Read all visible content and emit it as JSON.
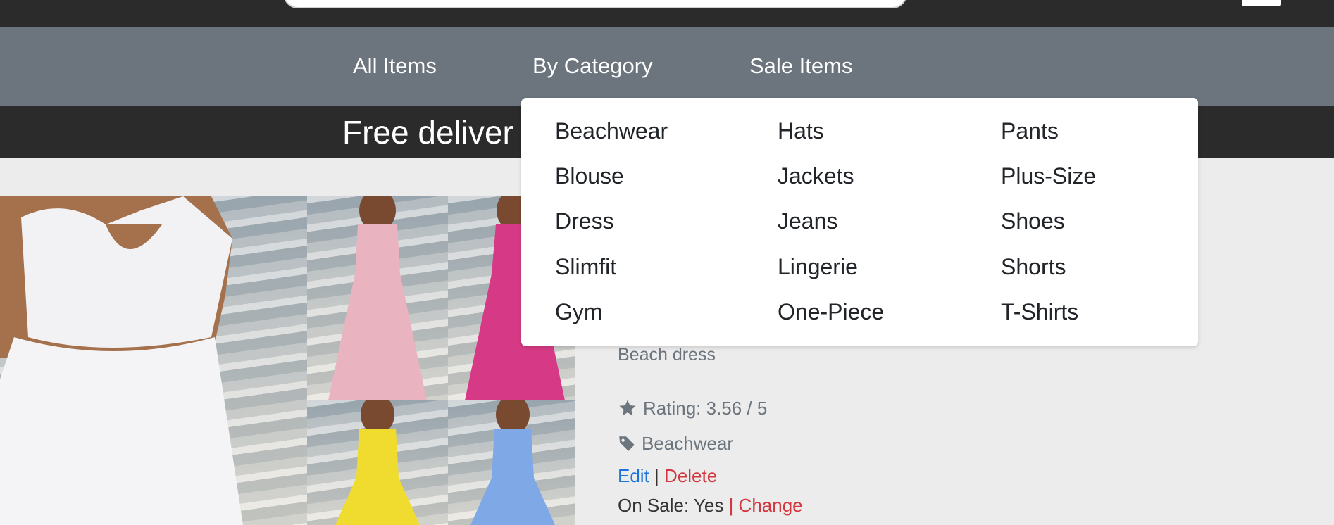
{
  "nav": {
    "all_items": "All Items",
    "by_category": "By Category",
    "sale_items": "Sale Items"
  },
  "banner": {
    "text": "Free deliver"
  },
  "dropdown": {
    "columns": [
      [
        "Beachwear",
        "Blouse",
        "Dress",
        "Slimfit",
        "Gym"
      ],
      [
        "Hats",
        "Jackets",
        "Jeans",
        "Lingerie",
        "One-Piece"
      ],
      [
        "Pants",
        "Plus-Size",
        "Shoes",
        "Shorts",
        "T-Shirts"
      ]
    ]
  },
  "product": {
    "description": "Beach dress",
    "rating_text": "Rating: 3.56 / 5",
    "rating_value": 3.56,
    "category": "Beachwear",
    "edit_label": "Edit",
    "separator": "|",
    "delete_label": "Delete",
    "on_sale_text": "On Sale: Yes",
    "change_label": "| Change"
  },
  "colors": {
    "navbar": "#6c757d",
    "topbar": "#2b2b2b",
    "link_blue": "#1e74d9",
    "link_red": "#d3373f",
    "dress_colors": [
      "#f2f2f4",
      "#e9b3c0",
      "#d63a86",
      "#f0dc2e",
      "#7fa8e6"
    ]
  },
  "icons": {
    "rating": "star-icon",
    "category": "tag-icon"
  }
}
